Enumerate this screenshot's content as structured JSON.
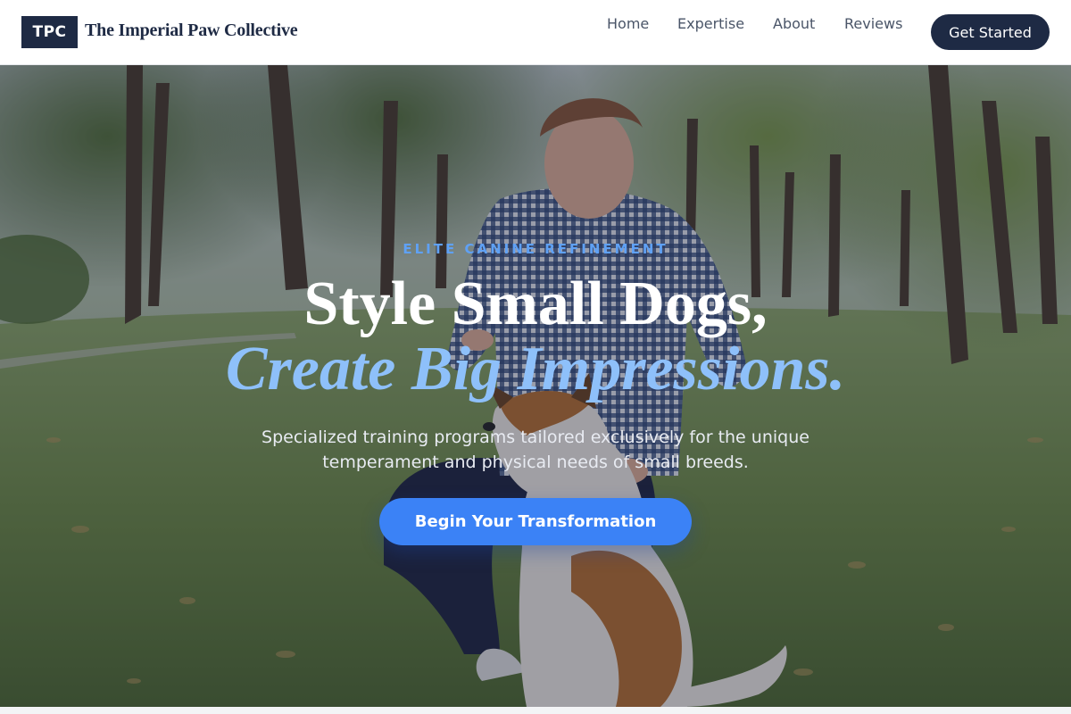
{
  "header": {
    "logo_badge": "TPC",
    "brand_name": "The Imperial Paw Collective",
    "nav": [
      "Home",
      "Expertise",
      "About",
      "Reviews"
    ],
    "cta_label": "Get Started"
  },
  "hero": {
    "eyebrow": "ELITE CANINE REFINEMENT",
    "headline_line1": "Style Small Dogs,",
    "headline_line2": "Create Big Impressions.",
    "subtext": "Specialized training programs tailored exclusively for the unique temperament and physical needs of small breeds.",
    "cta_label": "Begin Your Transformation",
    "background_image": "photo-young-man-training-small-dog-in-park"
  },
  "colors": {
    "navy": "#1e2a44",
    "accent_blue": "#3b82f6",
    "eyebrow_blue": "#5fa1f5",
    "italic_blue": "#8ec0fa"
  }
}
